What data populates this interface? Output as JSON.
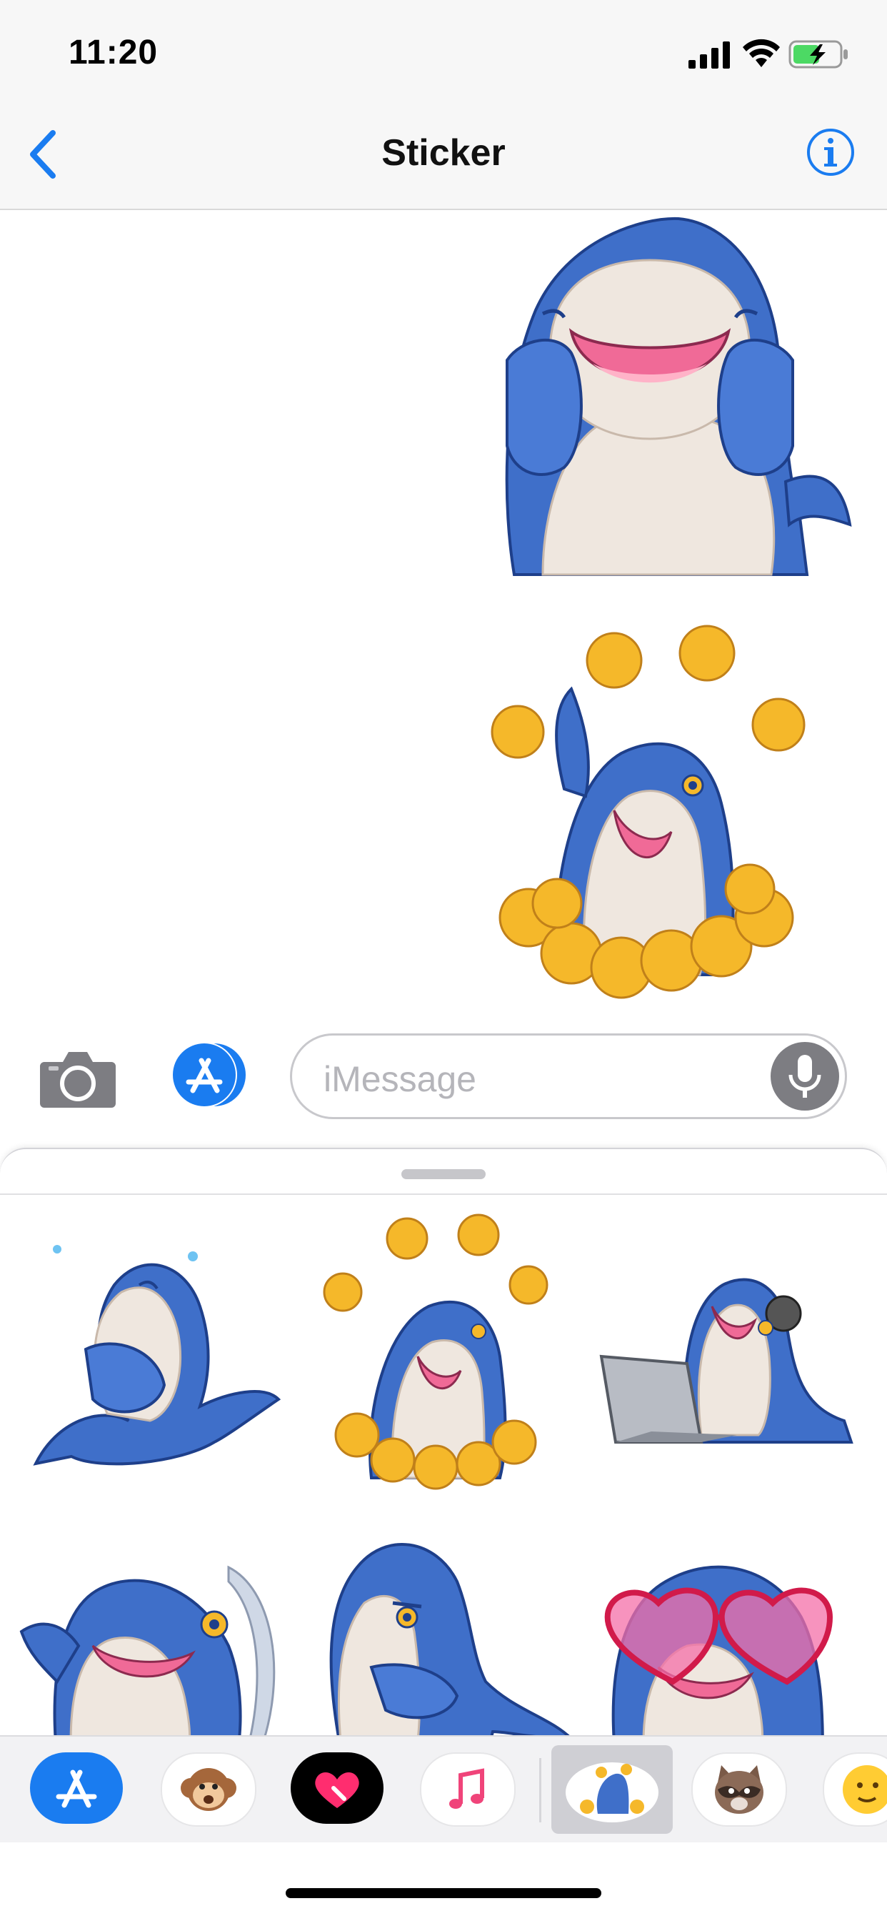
{
  "status_bar": {
    "time": "11:20",
    "icons": [
      "cellular-signal-icon",
      "wifi-icon",
      "battery-charging-icon"
    ],
    "battery_color": "#4cd964"
  },
  "nav": {
    "title": "Sticker",
    "back_icon": "chevron-left-icon",
    "info_icon": "info-icon",
    "accent_color": "#1a7cf0"
  },
  "conversation": {
    "messages": [
      {
        "type": "sticker",
        "description": "shark-laughing-sticker"
      },
      {
        "type": "sticker",
        "description": "shark-thumbs-up-sticker"
      }
    ]
  },
  "composer": {
    "camera_icon": "camera-icon",
    "apps_icon": "app-store-icon",
    "placeholder": "iMessage",
    "mic_icon": "microphone-icon"
  },
  "sticker_drawer": {
    "stickers": [
      "shark-crying-hug-sticker",
      "shark-thumbs-up-sticker",
      "shark-laptop-headphones-sticker",
      "shark-peeking-sticker",
      "shark-suspicious-sticker",
      "shark-heart-glasses-sticker"
    ]
  },
  "app_tray": {
    "apps": [
      {
        "name": "app-store-app",
        "icon": "app-store-icon"
      },
      {
        "name": "animoji-app",
        "icon": "monkey-icon"
      },
      {
        "name": "digital-touch-app",
        "icon": "heart-touch-icon"
      },
      {
        "name": "music-app",
        "icon": "music-note-icon"
      },
      {
        "name": "shark-sticker-app",
        "icon": "shark-sticker-icon",
        "selected": true
      },
      {
        "name": "raccoon-sticker-app",
        "icon": "raccoon-icon"
      },
      {
        "name": "emoji-sticker-app",
        "icon": "emoji-face-icon"
      }
    ]
  }
}
